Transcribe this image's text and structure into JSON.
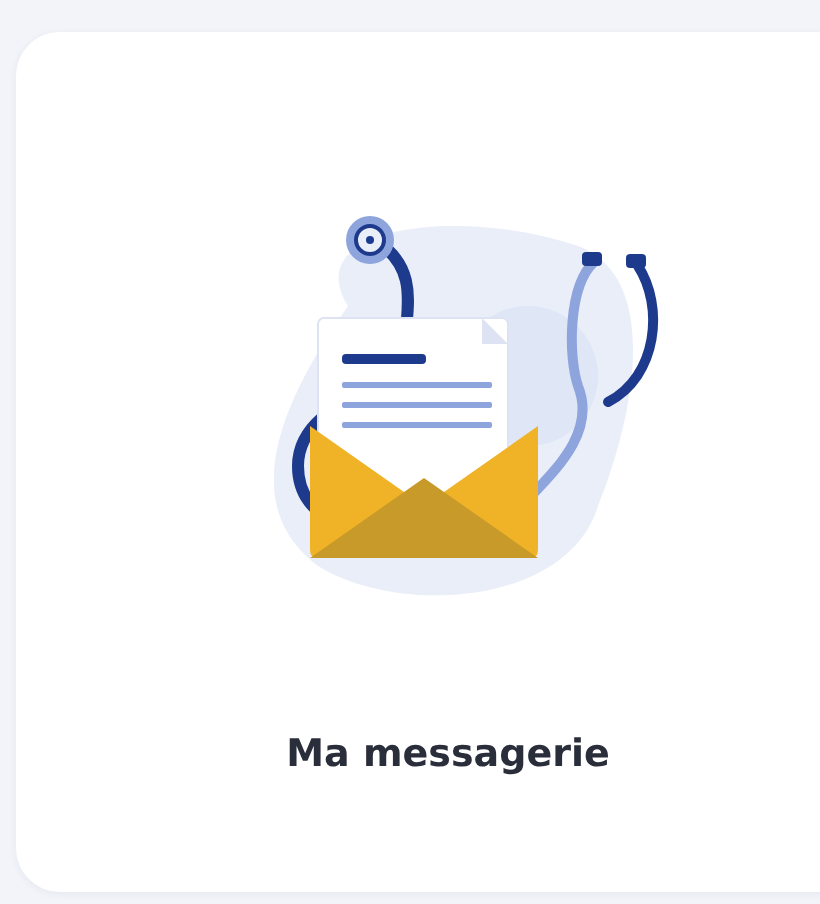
{
  "card": {
    "title": "Ma messagerie"
  }
}
